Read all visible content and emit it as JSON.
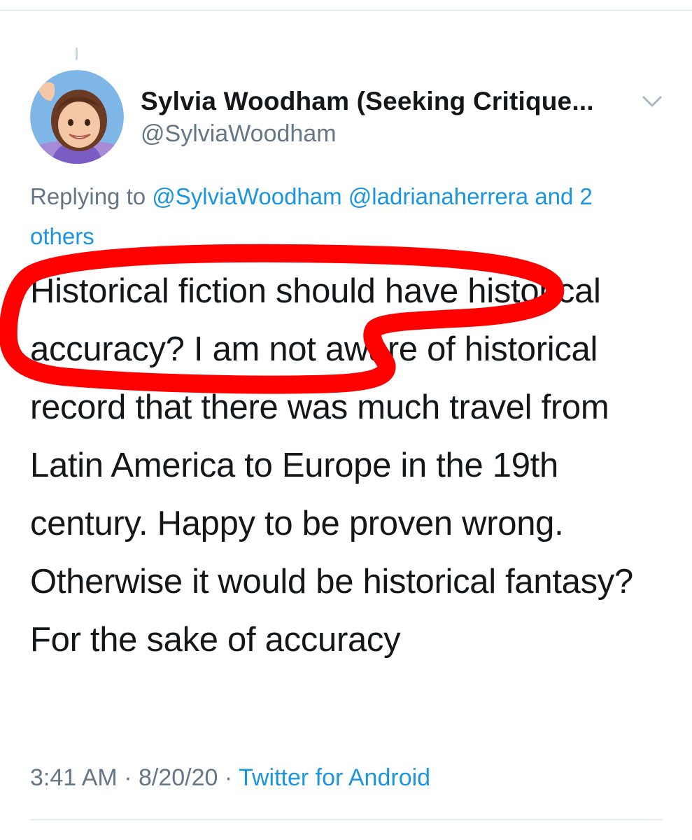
{
  "tweet": {
    "author": {
      "display_name": "Sylvia Woodham (Seeking Critique...",
      "handle": "@SylviaWoodham",
      "avatar_icon": "cartoon-avatar-icon"
    },
    "menu_icon": "chevron-down-icon",
    "replying": {
      "prefix": "Replying to",
      "mention_1": "@SylviaWoodham",
      "mention_2": "@ladrianaherrera",
      "others": "and 2 others"
    },
    "text": "Historical fiction should have historical accuracy? I am not aware of historical record that there was much travel from Latin America to Europe in the 19th century. Happy to be proven wrong. Otherwise it would be historical fantasy? For the sake of accuracy",
    "time": "3:41 AM",
    "date": "8/20/20",
    "separator": "·",
    "source": "Twitter for Android"
  },
  "colors": {
    "text": "#14171a",
    "secondary": "#657786",
    "link": "#1b95e0",
    "highlight": "#ff0000"
  }
}
